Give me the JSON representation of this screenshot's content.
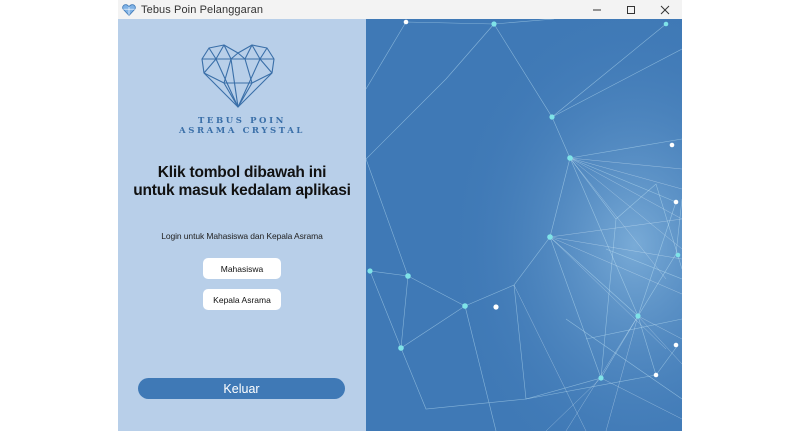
{
  "window": {
    "title": "Tebus Poin Pelanggaran",
    "controls": {
      "minimize_icon": "minimize-icon",
      "maximize_icon": "maximize-icon",
      "close_icon": "close-icon"
    }
  },
  "logo": {
    "line1": "TEBUS POIN",
    "line2": "ASRAMA CRYSTAL",
    "icon": "geometric-heart-icon",
    "color": "#3a6fa8"
  },
  "main": {
    "heading_line1": "Klik tombol dibawah ini",
    "heading_line2": "untuk masuk kedalam aplikasi",
    "login_label": "Login untuk Mahasiswa dan Kepala Asrama",
    "buttons": {
      "mahasiswa": "Mahasiswa",
      "kepala_asrama": "Kepala Asrama",
      "keluar": "Keluar"
    }
  },
  "colors": {
    "left_panel_bg": "#b8cfe9",
    "right_panel_bg": "#3f79b6",
    "accent": "#3f79b6",
    "node": "#7fe3e8"
  }
}
